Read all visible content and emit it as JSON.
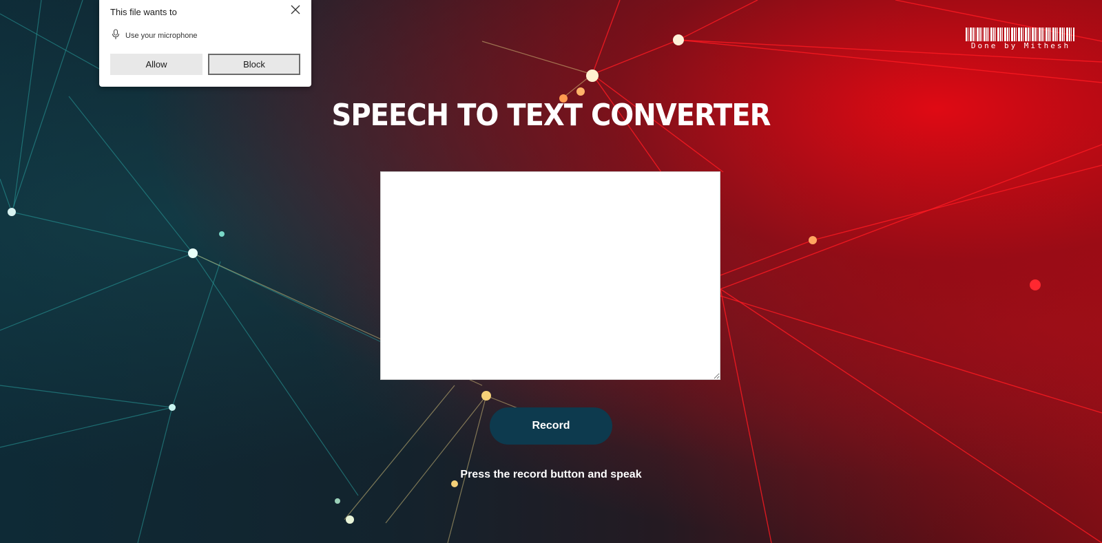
{
  "page": {
    "title": "SPEECH TO TEXT CONVERTER",
    "record_label": "Record",
    "hint": "Press the record button and speak",
    "transcript_value": ""
  },
  "credit": {
    "text": "Done by Mithesh"
  },
  "permission_dialog": {
    "title": "This file wants to",
    "permission": "Use your microphone",
    "permission_icon": "microphone-icon",
    "allow_label": "Allow",
    "block_label": "Block"
  },
  "colors": {
    "record_button": "#0d3a4e",
    "accent_red": "#e00a14",
    "accent_teal": "#1a7a80"
  }
}
